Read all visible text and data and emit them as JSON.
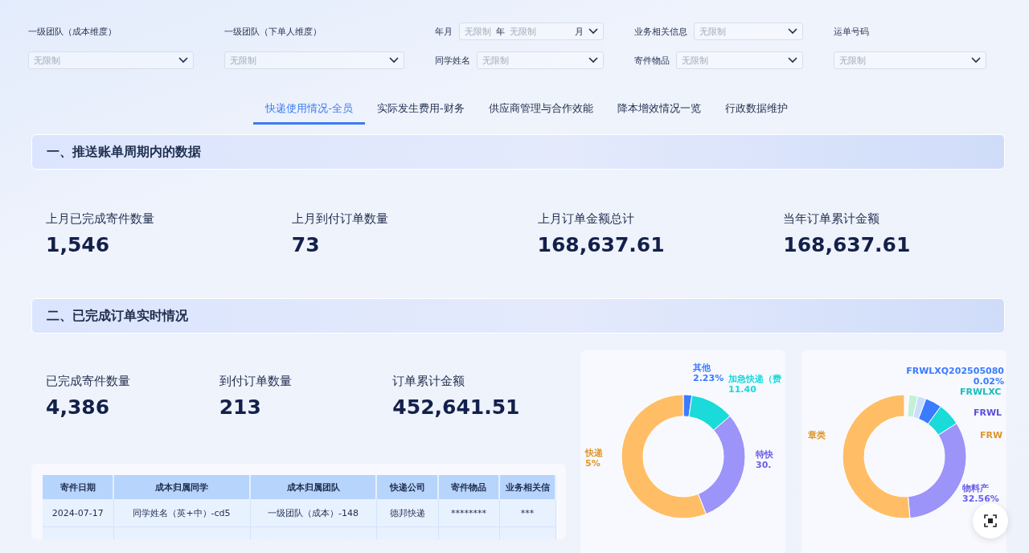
{
  "filters": [
    {
      "kind": "stacked",
      "label": "一级团队（成本维度）",
      "placeholder": "无限制"
    },
    {
      "kind": "stacked",
      "label": "一级团队（下单人维度）",
      "placeholder": "无限制"
    },
    {
      "kind": "inline",
      "rows": [
        {
          "label": "年月",
          "placeholder": "无限制",
          "unit": "年",
          "placeholder2": "无限制",
          "unit2": "月"
        },
        {
          "label": "同学姓名",
          "placeholder": "无限制"
        }
      ]
    },
    {
      "kind": "inline",
      "rows": [
        {
          "label": "业务相关信息",
          "placeholder": "无限制"
        },
        {
          "label": "寄件物品",
          "placeholder": "无限制"
        }
      ]
    },
    {
      "kind": "stacked",
      "label": "运单号码",
      "placeholder": "无限制"
    }
  ],
  "tabs": [
    {
      "label": "快递使用情况-全员",
      "selected": true
    },
    {
      "label": "实际发生费用-财务",
      "selected": false
    },
    {
      "label": "供应商管理与合作效能",
      "selected": false
    },
    {
      "label": "降本增效情况一览",
      "selected": false
    },
    {
      "label": "行政数据维护",
      "selected": false
    }
  ],
  "section_1": {
    "title": "一、推送账单周期内的数据",
    "stats": [
      {
        "label": "上月已完成寄件数量",
        "value": "1,546"
      },
      {
        "label": "上月到付订单数量",
        "value": "73"
      },
      {
        "label": "上月订单金额总计",
        "value": "168,637.61"
      },
      {
        "label": "当年订单累计金额",
        "value": "168,637.61"
      }
    ]
  },
  "section_2": {
    "title": "二、已完成订单实时情况",
    "stats": [
      {
        "label": "已完成寄件数量",
        "value": "4,386"
      },
      {
        "label": "到付订单数量",
        "value": "213"
      },
      {
        "label": "订单累计金额",
        "value": "452,641.51"
      }
    ],
    "table": {
      "columns": [
        "寄件日期",
        "成本归属同学",
        "成本归属团队",
        "快递公司",
        "寄件物品",
        "业务相关信"
      ],
      "rows": [
        [
          "2024-07-17",
          "同学姓名（英+中）-cd5",
          "一级团队（成本）-148",
          "德邦快递",
          "********",
          "***"
        ]
      ]
    },
    "donuts": [
      {
        "labels": [
          {
            "name": "其他",
            "value": "2.23%",
            "color": "#3b7bff"
          },
          {
            "name": "加急快递（费",
            "value": "11.40",
            "color": "#1adada"
          },
          {
            "name": "特快",
            "value": "30.",
            "color": "#6a5ee8"
          },
          {
            "name": "快递",
            "value": "5%",
            "color": "#e0962a"
          }
        ]
      },
      {
        "labels": [
          {
            "name": "FRWLXQ202505080",
            "value": "0.02%",
            "color": "#3b7bff"
          },
          {
            "name": "FRWLXC",
            "color": "#1abcbc"
          },
          {
            "name": "FRWL",
            "color": "#5b4fe0"
          },
          {
            "name": "章类",
            "color": "#e0962a"
          },
          {
            "name": "FRW",
            "color": "#e0962a"
          },
          {
            "name": "物料产",
            "value": "32.56%",
            "color": "#6a5ee8"
          }
        ]
      }
    ]
  }
}
